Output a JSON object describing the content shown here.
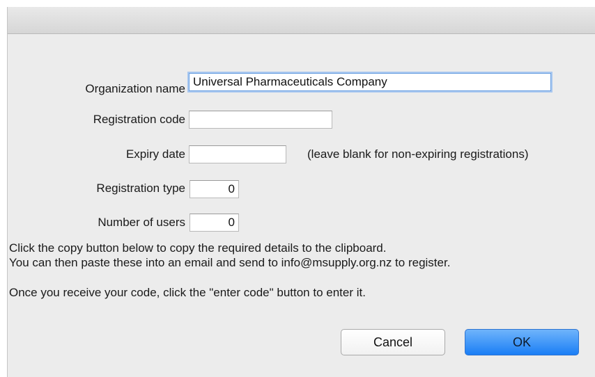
{
  "form": {
    "org_name_label": "Organization name",
    "org_name_value": "Universal Pharmaceuticals Company",
    "reg_code_label": "Registration code",
    "reg_code_value": "",
    "expiry_label": "Expiry date",
    "expiry_value": "",
    "expiry_hint": "(leave blank for non-expiring registrations)",
    "reg_type_label": "Registration type",
    "reg_type_value": "0",
    "users_label": "Number of users",
    "users_value": "0"
  },
  "instructions": {
    "line1": "Click the copy button below to copy the required details to the clipboard.",
    "line2": "You can then paste these into an email and send to info@msupply.org.nz to register.",
    "line3": "Once you receive your code, click the \"enter code\" button to enter it."
  },
  "buttons": {
    "cancel_label": "Cancel",
    "ok_label": "OK"
  },
  "colors": {
    "accent": "#1a7ef5",
    "dialog_bg": "#ececec"
  }
}
